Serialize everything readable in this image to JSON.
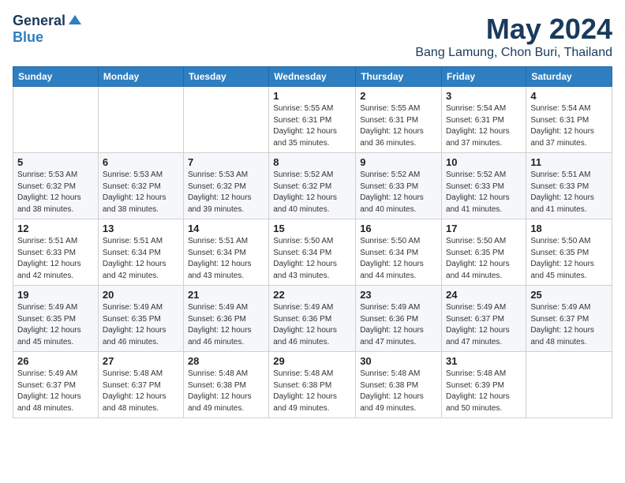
{
  "header": {
    "logo_general": "General",
    "logo_blue": "Blue",
    "title": "May 2024",
    "subtitle": "Bang Lamung, Chon Buri, Thailand"
  },
  "days_of_week": [
    "Sunday",
    "Monday",
    "Tuesday",
    "Wednesday",
    "Thursday",
    "Friday",
    "Saturday"
  ],
  "weeks": [
    [
      {
        "day": "",
        "info": ""
      },
      {
        "day": "",
        "info": ""
      },
      {
        "day": "",
        "info": ""
      },
      {
        "day": "1",
        "info": "Sunrise: 5:55 AM\nSunset: 6:31 PM\nDaylight: 12 hours\nand 35 minutes."
      },
      {
        "day": "2",
        "info": "Sunrise: 5:55 AM\nSunset: 6:31 PM\nDaylight: 12 hours\nand 36 minutes."
      },
      {
        "day": "3",
        "info": "Sunrise: 5:54 AM\nSunset: 6:31 PM\nDaylight: 12 hours\nand 37 minutes."
      },
      {
        "day": "4",
        "info": "Sunrise: 5:54 AM\nSunset: 6:31 PM\nDaylight: 12 hours\nand 37 minutes."
      }
    ],
    [
      {
        "day": "5",
        "info": "Sunrise: 5:53 AM\nSunset: 6:32 PM\nDaylight: 12 hours\nand 38 minutes."
      },
      {
        "day": "6",
        "info": "Sunrise: 5:53 AM\nSunset: 6:32 PM\nDaylight: 12 hours\nand 38 minutes."
      },
      {
        "day": "7",
        "info": "Sunrise: 5:53 AM\nSunset: 6:32 PM\nDaylight: 12 hours\nand 39 minutes."
      },
      {
        "day": "8",
        "info": "Sunrise: 5:52 AM\nSunset: 6:32 PM\nDaylight: 12 hours\nand 40 minutes."
      },
      {
        "day": "9",
        "info": "Sunrise: 5:52 AM\nSunset: 6:33 PM\nDaylight: 12 hours\nand 40 minutes."
      },
      {
        "day": "10",
        "info": "Sunrise: 5:52 AM\nSunset: 6:33 PM\nDaylight: 12 hours\nand 41 minutes."
      },
      {
        "day": "11",
        "info": "Sunrise: 5:51 AM\nSunset: 6:33 PM\nDaylight: 12 hours\nand 41 minutes."
      }
    ],
    [
      {
        "day": "12",
        "info": "Sunrise: 5:51 AM\nSunset: 6:33 PM\nDaylight: 12 hours\nand 42 minutes."
      },
      {
        "day": "13",
        "info": "Sunrise: 5:51 AM\nSunset: 6:34 PM\nDaylight: 12 hours\nand 42 minutes."
      },
      {
        "day": "14",
        "info": "Sunrise: 5:51 AM\nSunset: 6:34 PM\nDaylight: 12 hours\nand 43 minutes."
      },
      {
        "day": "15",
        "info": "Sunrise: 5:50 AM\nSunset: 6:34 PM\nDaylight: 12 hours\nand 43 minutes."
      },
      {
        "day": "16",
        "info": "Sunrise: 5:50 AM\nSunset: 6:34 PM\nDaylight: 12 hours\nand 44 minutes."
      },
      {
        "day": "17",
        "info": "Sunrise: 5:50 AM\nSunset: 6:35 PM\nDaylight: 12 hours\nand 44 minutes."
      },
      {
        "day": "18",
        "info": "Sunrise: 5:50 AM\nSunset: 6:35 PM\nDaylight: 12 hours\nand 45 minutes."
      }
    ],
    [
      {
        "day": "19",
        "info": "Sunrise: 5:49 AM\nSunset: 6:35 PM\nDaylight: 12 hours\nand 45 minutes."
      },
      {
        "day": "20",
        "info": "Sunrise: 5:49 AM\nSunset: 6:35 PM\nDaylight: 12 hours\nand 46 minutes."
      },
      {
        "day": "21",
        "info": "Sunrise: 5:49 AM\nSunset: 6:36 PM\nDaylight: 12 hours\nand 46 minutes."
      },
      {
        "day": "22",
        "info": "Sunrise: 5:49 AM\nSunset: 6:36 PM\nDaylight: 12 hours\nand 46 minutes."
      },
      {
        "day": "23",
        "info": "Sunrise: 5:49 AM\nSunset: 6:36 PM\nDaylight: 12 hours\nand 47 minutes."
      },
      {
        "day": "24",
        "info": "Sunrise: 5:49 AM\nSunset: 6:37 PM\nDaylight: 12 hours\nand 47 minutes."
      },
      {
        "day": "25",
        "info": "Sunrise: 5:49 AM\nSunset: 6:37 PM\nDaylight: 12 hours\nand 48 minutes."
      }
    ],
    [
      {
        "day": "26",
        "info": "Sunrise: 5:49 AM\nSunset: 6:37 PM\nDaylight: 12 hours\nand 48 minutes."
      },
      {
        "day": "27",
        "info": "Sunrise: 5:48 AM\nSunset: 6:37 PM\nDaylight: 12 hours\nand 48 minutes."
      },
      {
        "day": "28",
        "info": "Sunrise: 5:48 AM\nSunset: 6:38 PM\nDaylight: 12 hours\nand 49 minutes."
      },
      {
        "day": "29",
        "info": "Sunrise: 5:48 AM\nSunset: 6:38 PM\nDaylight: 12 hours\nand 49 minutes."
      },
      {
        "day": "30",
        "info": "Sunrise: 5:48 AM\nSunset: 6:38 PM\nDaylight: 12 hours\nand 49 minutes."
      },
      {
        "day": "31",
        "info": "Sunrise: 5:48 AM\nSunset: 6:39 PM\nDaylight: 12 hours\nand 50 minutes."
      },
      {
        "day": "",
        "info": ""
      }
    ]
  ]
}
